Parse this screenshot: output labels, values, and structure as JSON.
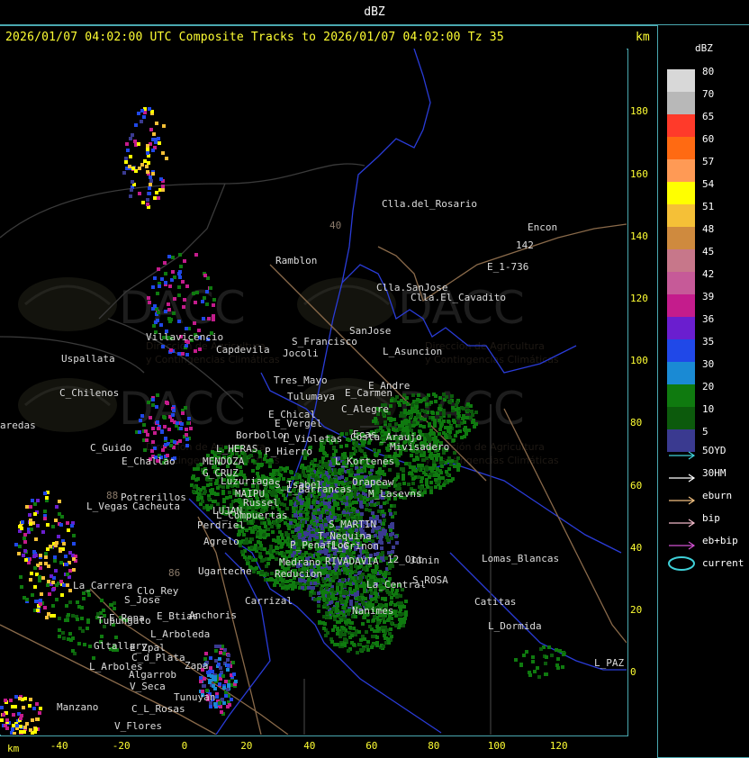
{
  "header": {
    "title": "dBZ"
  },
  "map_title": "2026/01/07 04:02:00 UTC Composite Tracks to 2026/01/07 04:02:00 Tz 35",
  "axis": {
    "unit_top": "km",
    "unit_bottom": "km",
    "y_ticks": [
      "180",
      "160",
      "140",
      "120",
      "100",
      "80",
      "60",
      "40",
      "20",
      "0"
    ],
    "x_ticks": [
      "-40",
      "-20",
      "0",
      "20",
      "40",
      "60",
      "80",
      "100",
      "120"
    ]
  },
  "legend": {
    "title": "dBZ",
    "levels": [
      {
        "label": "80",
        "color": "#d8d8d8"
      },
      {
        "label": "70",
        "color": "#b8b8b8"
      },
      {
        "label": "65",
        "color": "#ff3a2a"
      },
      {
        "label": "60",
        "color": "#ff6a12"
      },
      {
        "label": "57",
        "color": "#ff9a55"
      },
      {
        "label": "54",
        "color": "#ffff00"
      },
      {
        "label": "51",
        "color": "#f5c037"
      },
      {
        "label": "48",
        "color": "#cf8a3e"
      },
      {
        "label": "45",
        "color": "#c7778a"
      },
      {
        "label": "42",
        "color": "#c65a98"
      },
      {
        "label": "39",
        "color": "#c41c8c"
      },
      {
        "label": "36",
        "color": "#6a1ecf"
      },
      {
        "label": "35",
        "color": "#2048e8"
      },
      {
        "label": "30",
        "color": "#1a8ad4"
      },
      {
        "label": "20",
        "color": "#0f7a0f"
      },
      {
        "label": "10",
        "color": "#0c5a0c"
      },
      {
        "label": "5",
        "color": "#3a3a90"
      }
    ],
    "tracks": [
      {
        "label": "5OYD",
        "color": "#3fd0d8"
      },
      {
        "label": "30HM",
        "color": "#ffffff"
      },
      {
        "label": "eburn",
        "color": "#f2c080"
      },
      {
        "label": "bip",
        "color": "#f0b8c8"
      },
      {
        "label": "eb+bip",
        "color": "#d050d0"
      },
      {
        "label": "current",
        "color": "#3fd0d8"
      }
    ]
  },
  "watermarks": [
    {
      "logo": "DACC",
      "line1": "Dirección de Agricultura",
      "line2": "y Contingencias Climáticas"
    },
    {
      "logo": "DACC",
      "line1": "Dirección de Agricultura",
      "line2": "y Contingencias Climáticas"
    },
    {
      "logo": "DACC",
      "line1": "Dirección de Agricultura",
      "line2": "y Contingencias Climáticas"
    },
    {
      "logo": "DACC",
      "line1": "Dirección de Agricultura",
      "line2": "y Contingencias Climáticas"
    }
  ],
  "places": [
    "Clla.del_Rosario",
    "Encon",
    "142",
    "E_1-736",
    "Ramblon",
    "Clla.SanJose",
    "Clla.El_Cavadito",
    "Villavicencio",
    "Capdevila",
    "S_Francisco",
    "SanJose",
    "Uspallata",
    "Jocoli",
    "L_Asuncion",
    "Tres_Mayo",
    "E_Andre",
    "C_Chilenos",
    "Tulumaya",
    "E_Carmen",
    "E_Chical",
    "C_Alegre",
    "aredas",
    "E_Vergel",
    "Borbollon",
    "Costa_Araujo",
    "L_Violetas",
    "Ecas",
    "Mivisadero",
    "C_Guido",
    "L_HERAS",
    "P_Hierro",
    "E_Challao",
    "MENDOZA",
    "L_Kortenes",
    "G_CRUZ",
    "Luzuriaga",
    "S_Isabel",
    "Orapeaw",
    "MAIPU",
    "Russel",
    "L_Barrancas",
    "M_Lasevns",
    "Potrerillos",
    "L_Vegas",
    "Cacheuta",
    "LUJAN",
    "L_Compuertas",
    "Perdriel",
    "S_MARTIN",
    "Agrelo",
    "T_Nequina",
    "P_Penaflor",
    "L_Grinon",
    "Ugarteche",
    "Medrano",
    "RIVADAVIA",
    "Junin",
    "12_Oct",
    "Lomas_Blancas",
    "La_Carrera",
    "Clo_Rey",
    "Reducion",
    "La_Central",
    "S_ROSA",
    "S_Jose",
    "E_Pena",
    "Anchoris",
    "Carrizal",
    "Catitas",
    "E_Btias",
    "Tupungato",
    "L_Arboleda",
    "Nanimes",
    "L_Dormida",
    "Gltallary",
    "E_Zpal",
    "L_Arboles",
    "C_d_Plata",
    "L_PAZ",
    "Algarrob",
    "V_Seca",
    "Zapa",
    "Tunuyan",
    "Manzano",
    "C_L_Rosas",
    "V_Flores",
    "88",
    "86",
    "40"
  ]
}
